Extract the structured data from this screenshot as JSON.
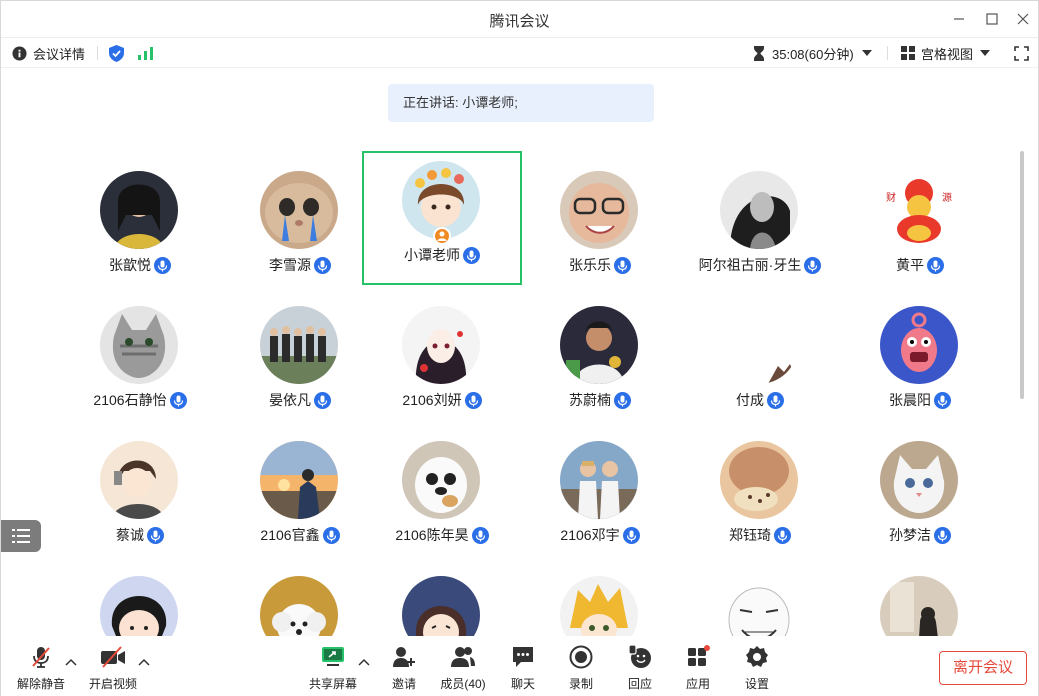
{
  "window": {
    "title": "腾讯会议"
  },
  "infobar": {
    "meeting_details": "会议详情",
    "timer": "35:08(60分钟)",
    "view_mode": "宫格视图"
  },
  "speaking": {
    "text": "正在讲话: 小谭老师;"
  },
  "participants": [
    {
      "name": "张歆悦",
      "mic": "on",
      "active": false,
      "avatar": "photo-girl-dark"
    },
    {
      "name": "李雪源",
      "mic": "on",
      "active": false,
      "avatar": "crying-cat"
    },
    {
      "name": "小谭老师",
      "mic": "on",
      "active": true,
      "host": true,
      "avatar": "anime-girl-flowers"
    },
    {
      "name": "张乐乐",
      "mic": "on",
      "active": false,
      "avatar": "smiling-girl-glasses"
    },
    {
      "name": "阿尔祖古丽·牙生",
      "mic": "on",
      "active": false,
      "avatar": "bw-portrait"
    },
    {
      "name": "黄平",
      "mic": "on",
      "active": false,
      "avatar": "fortune-god"
    },
    {
      "name": "2106石静怡",
      "mic": "on",
      "active": false,
      "avatar": "grey-cat"
    },
    {
      "name": "晏依凡",
      "mic": "on",
      "active": false,
      "avatar": "group-photo"
    },
    {
      "name": "2106刘妍",
      "mic": "on",
      "active": false,
      "avatar": "anime-dark-hair"
    },
    {
      "name": "苏蔚楠",
      "mic": "on",
      "active": false,
      "avatar": "athlete-medal"
    },
    {
      "name": "付成",
      "mic": "on",
      "active": false,
      "avatar": "white-cat-corner"
    },
    {
      "name": "张晨阳",
      "mic": "on",
      "active": false,
      "avatar": "pink-cartoon"
    },
    {
      "name": "蔡诚",
      "mic": "on",
      "active": false,
      "avatar": "anime-boy-phone"
    },
    {
      "name": "2106官鑫",
      "mic": "on",
      "active": false,
      "avatar": "sunset-sitting"
    },
    {
      "name": "2106陈年昊",
      "mic": "on",
      "active": false,
      "avatar": "panda-bear"
    },
    {
      "name": "2106邓宇",
      "mic": "on",
      "active": false,
      "avatar": "two-boys"
    },
    {
      "name": "郑钰琦",
      "mic": "on",
      "active": false,
      "avatar": "cookie-dog"
    },
    {
      "name": "孙梦洁",
      "mic": "on",
      "active": false,
      "avatar": "kitten"
    },
    {
      "name": "",
      "avatar": "maruko-girl"
    },
    {
      "name": "",
      "avatar": "white-puppy"
    },
    {
      "name": "",
      "avatar": "anime-laughing"
    },
    {
      "name": "",
      "avatar": "anime-blonde"
    },
    {
      "name": "",
      "avatar": "meme-face"
    },
    {
      "name": "",
      "avatar": "window-silhouette"
    }
  ],
  "toolbar": {
    "unmute": "解除静音",
    "start_video": "开启视频",
    "share_screen": "共享屏幕",
    "invite": "邀请",
    "members": "成员(40)",
    "chat": "聊天",
    "record": "录制",
    "reaction": "回应",
    "apps": "应用",
    "settings": "设置",
    "leave": "离开会议"
  },
  "colors": {
    "accent": "#2a6ee8",
    "active_border": "#26c26a",
    "leave": "#e64a3a",
    "signal": "#26c26a"
  }
}
